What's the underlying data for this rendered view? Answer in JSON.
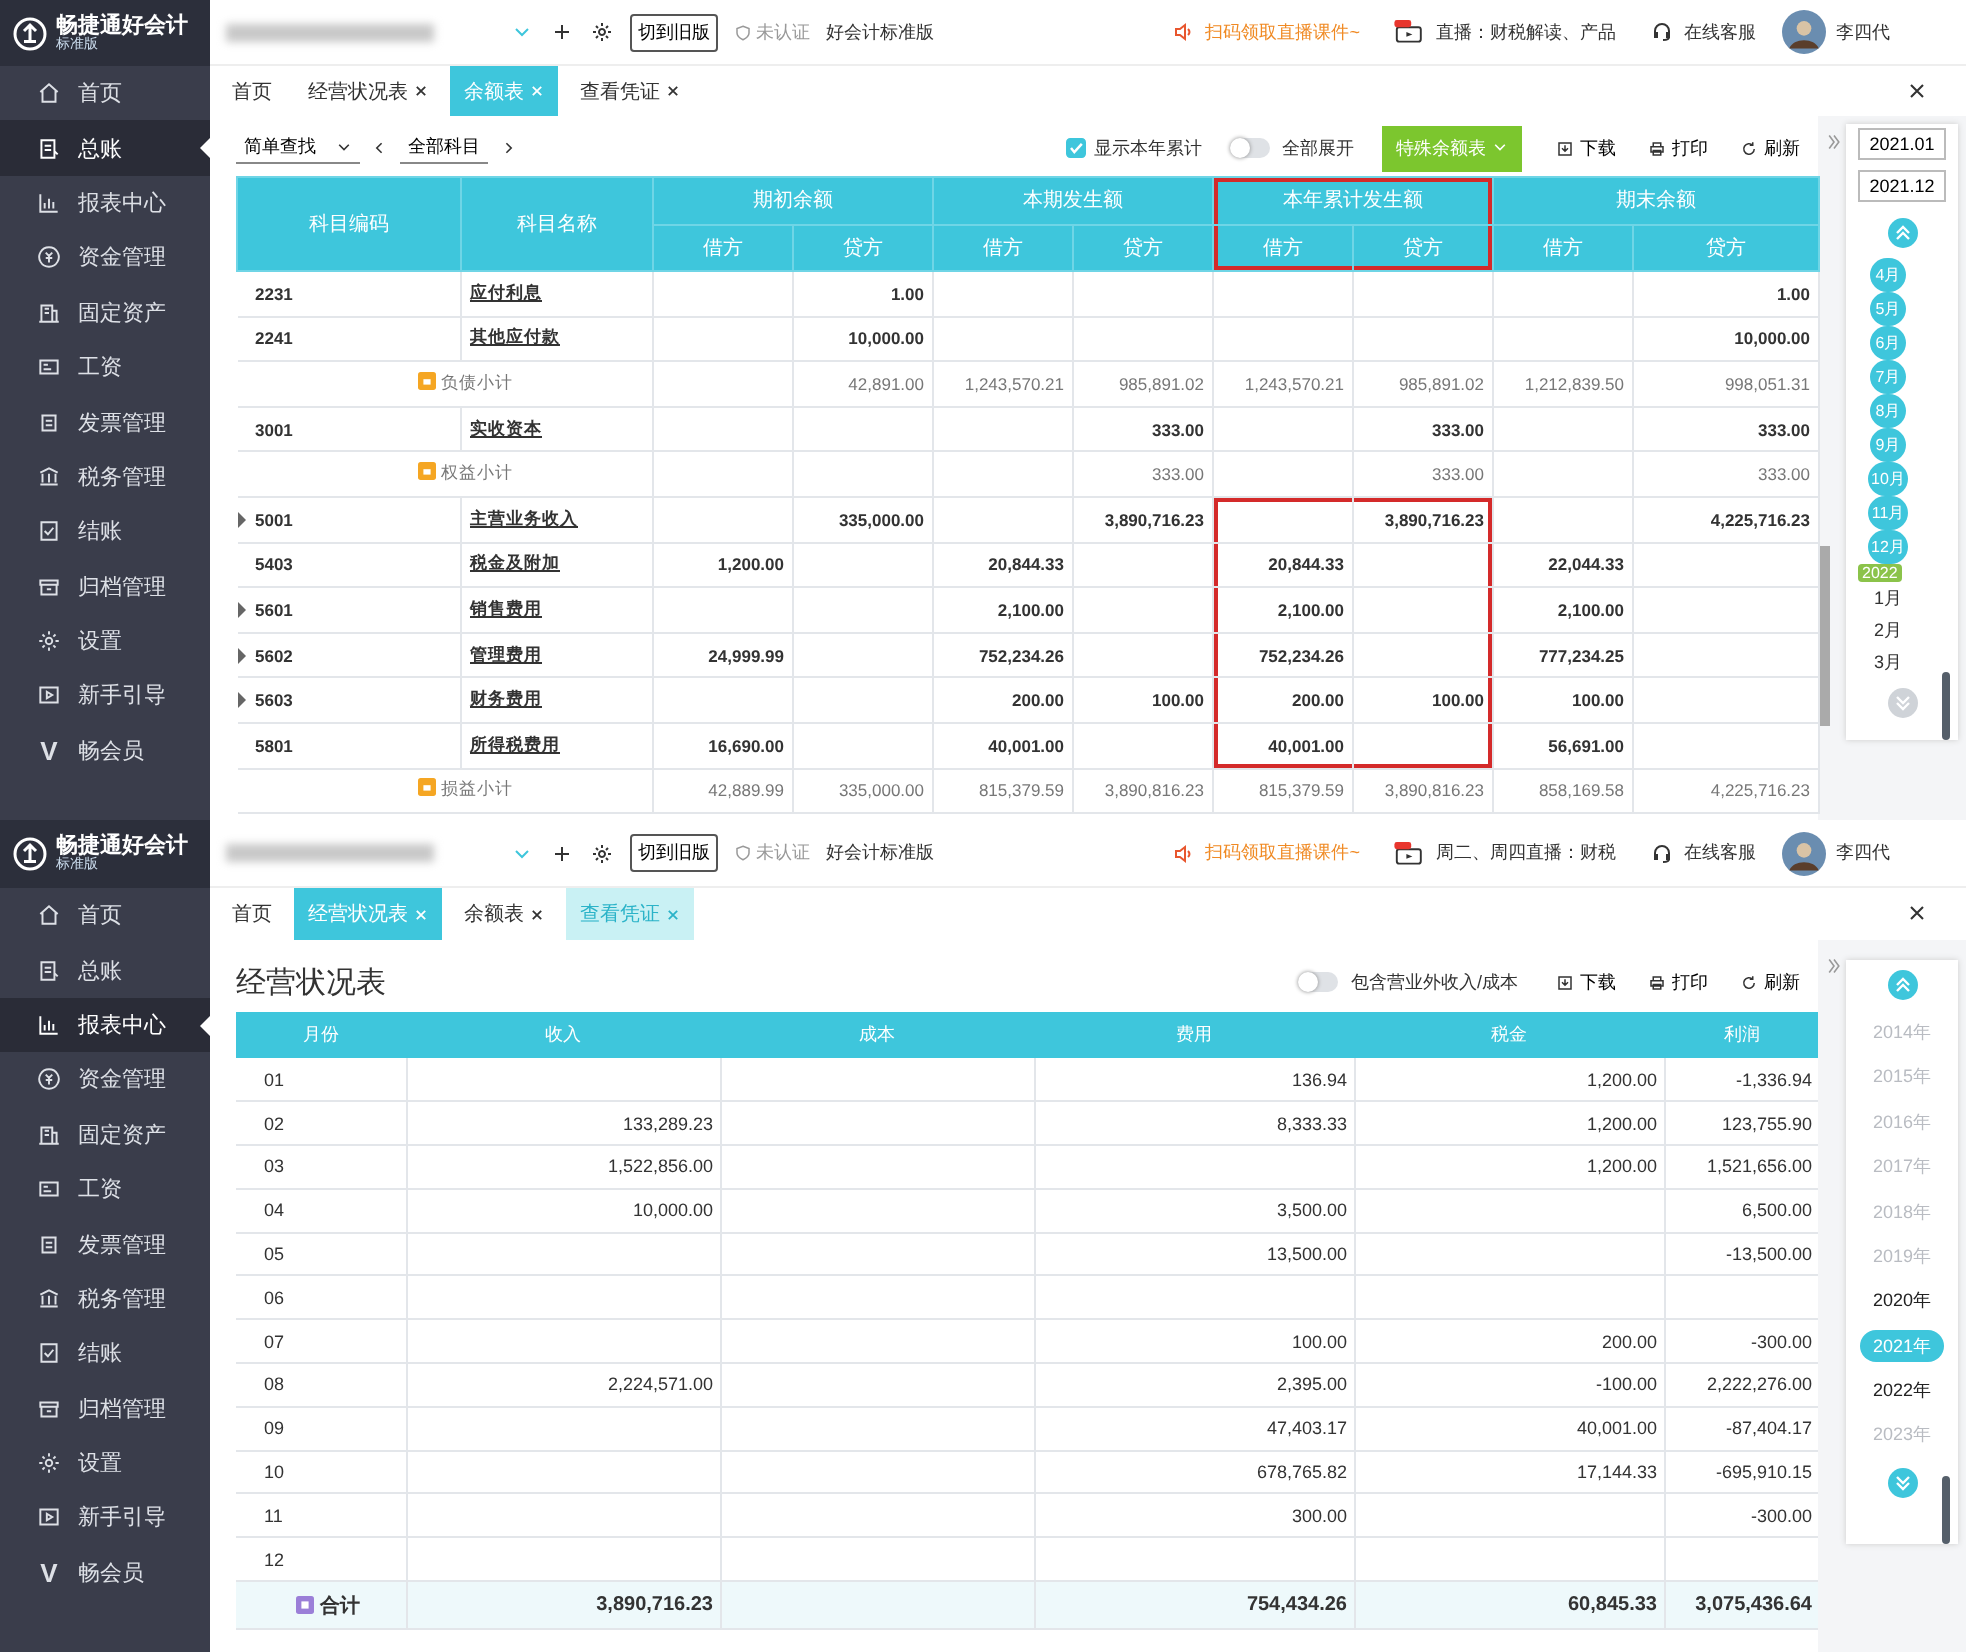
{
  "screens": [
    {
      "kind": "balance",
      "header": {
        "logo": "畅捷通好会计",
        "edition": "标准版",
        "switch_button": "切到旧版",
        "cert": "未认证",
        "product": "好会计标准版",
        "promo": "扫码领取直播课件~",
        "live": "直播：财税解读、产品",
        "service": "在线客服",
        "user": "李四代"
      },
      "sidebar": [
        {
          "label": "首页",
          "selected": false
        },
        {
          "label": "总账",
          "selected": true
        },
        {
          "label": "报表中心",
          "selected": false
        },
        {
          "label": "资金管理",
          "selected": false
        },
        {
          "label": "固定资产",
          "selected": false
        },
        {
          "label": "工资",
          "selected": false
        },
        {
          "label": "发票管理",
          "selected": false
        },
        {
          "label": "税务管理",
          "selected": false
        },
        {
          "label": "结账",
          "selected": false
        },
        {
          "label": "归档管理",
          "selected": false
        },
        {
          "label": "设置",
          "selected": false
        },
        {
          "label": "新手引导",
          "selected": false
        },
        {
          "label": "畅会员",
          "selected": false,
          "glyph": "V"
        }
      ],
      "tabs": [
        {
          "label": "首页",
          "closable": false,
          "selected": false,
          "highlighted": false
        },
        {
          "label": "经营状况表",
          "closable": true,
          "selected": false,
          "highlighted": false
        },
        {
          "label": "余额表",
          "closable": true,
          "selected": true,
          "highlighted": false
        },
        {
          "label": "查看凭证",
          "closable": true,
          "selected": false,
          "highlighted": false
        }
      ],
      "toolbar": {
        "search_mode": "简单查找",
        "scope": "全部科目",
        "show_year_total": {
          "label": "显示本年累计",
          "checked": true
        },
        "expand_all": {
          "label": "全部展开",
          "on": false
        },
        "special_button": "特殊余额表",
        "actions": [
          "下载",
          "打印",
          "刷新"
        ]
      },
      "table": {
        "code_header": "科目编码",
        "name_header": "科目名称",
        "groups": [
          {
            "label": "期初余额",
            "boxed": false,
            "sub": [
              "借方",
              "贷方"
            ]
          },
          {
            "label": "本期发生额",
            "boxed": false,
            "sub": [
              "借方",
              "贷方"
            ]
          },
          {
            "label": "本年累计发生额",
            "boxed": true,
            "sub": [
              "借方",
              "贷方"
            ]
          },
          {
            "label": "期末余额",
            "boxed": false,
            "sub": [
              "借方",
              "贷方"
            ]
          }
        ],
        "rows": [
          {
            "kind": "account",
            "code": "2231",
            "name": "应付利息",
            "expandable": false,
            "boxed": false,
            "opening_credit": "1.00",
            "closing_credit": "1.00"
          },
          {
            "kind": "account",
            "code": "2241",
            "name": "其他应付款",
            "expandable": false,
            "boxed": false,
            "opening_credit": "10,000.00",
            "closing_credit": "10,000.00"
          },
          {
            "kind": "subtotal",
            "name": "负债小计",
            "boxed": false,
            "opening_credit": "42,891.00",
            "period_debit": "1,243,570.21",
            "period_credit": "985,891.02",
            "ytd_debit": "1,243,570.21",
            "ytd_credit": "985,891.02",
            "closing_debit": "1,212,839.50",
            "closing_credit": "998,051.31"
          },
          {
            "kind": "account",
            "code": "3001",
            "name": "实收资本",
            "expandable": false,
            "boxed": false,
            "period_credit": "333.00",
            "ytd_credit": "333.00",
            "closing_credit": "333.00"
          },
          {
            "kind": "subtotal",
            "name": "权益小计",
            "boxed": false,
            "period_credit": "333.00",
            "ytd_credit": "333.00",
            "closing_credit": "333.00"
          },
          {
            "kind": "account",
            "code": "5001",
            "name": "主营业务收入",
            "expandable": true,
            "boxed": true,
            "opening_credit": "335,000.00",
            "period_credit": "3,890,716.23",
            "ytd_credit": "3,890,716.23",
            "closing_credit": "4,225,716.23"
          },
          {
            "kind": "account",
            "code": "5403",
            "name": "税金及附加",
            "expandable": false,
            "boxed": true,
            "opening_debit": "1,200.00",
            "period_debit": "20,844.33",
            "ytd_debit": "20,844.33",
            "closing_debit": "22,044.33"
          },
          {
            "kind": "account",
            "code": "5601",
            "name": "销售费用",
            "expandable": true,
            "boxed": true,
            "period_debit": "2,100.00",
            "ytd_debit": "2,100.00",
            "closing_debit": "2,100.00"
          },
          {
            "kind": "account",
            "code": "5602",
            "name": "管理费用",
            "expandable": true,
            "boxed": true,
            "opening_debit": "24,999.99",
            "period_debit": "752,234.26",
            "ytd_debit": "752,234.26",
            "closing_debit": "777,234.25"
          },
          {
            "kind": "account",
            "code": "5603",
            "name": "财务费用",
            "expandable": true,
            "boxed": true,
            "period_debit": "200.00",
            "period_credit": "100.00",
            "ytd_debit": "200.00",
            "ytd_credit": "100.00",
            "closing_debit": "100.00"
          },
          {
            "kind": "account",
            "code": "5801",
            "name": "所得税费用",
            "expandable": false,
            "boxed": true,
            "opening_debit": "16,690.00",
            "period_debit": "40,001.00",
            "ytd_debit": "40,001.00",
            "closing_debit": "56,691.00"
          },
          {
            "kind": "subtotal",
            "name": "损益小计",
            "boxed": false,
            "opening_debit": "42,889.99",
            "opening_credit": "335,000.00",
            "period_debit": "815,379.59",
            "period_credit": "3,890,816.23",
            "ytd_debit": "815,379.59",
            "ytd_credit": "3,890,816.23",
            "closing_debit": "858,169.58",
            "closing_credit": "4,225,716.23"
          }
        ]
      },
      "side_panel": {
        "kind": "months",
        "dates": [
          "2021.01",
          "2021.12"
        ],
        "up_button": {
          "disabled": false
        },
        "down_button": {
          "disabled": true
        },
        "items": [
          {
            "label": "4月",
            "selected": true
          },
          {
            "label": "5月",
            "selected": true
          },
          {
            "label": "6月",
            "selected": true
          },
          {
            "label": "7月",
            "selected": true
          },
          {
            "label": "8月",
            "selected": true
          },
          {
            "label": "9月",
            "selected": true
          },
          {
            "label": "10月",
            "selected": true
          },
          {
            "label": "11月",
            "selected": true
          },
          {
            "label": "12月",
            "selected": true
          },
          {
            "label": "1月",
            "selected": false,
            "year_badge": "2022"
          },
          {
            "label": "2月",
            "selected": false
          },
          {
            "label": "3月",
            "selected": false
          }
        ]
      }
    },
    {
      "kind": "report",
      "header": {
        "logo": "畅捷通好会计",
        "edition": "标准版",
        "switch_button": "切到旧版",
        "cert": "未认证",
        "product": "好会计标准版",
        "promo": "扫码领取直播课件~",
        "live": "周二、周四直播：财税",
        "service": "在线客服",
        "user": "李四代"
      },
      "sidebar": [
        {
          "label": "首页",
          "selected": false
        },
        {
          "label": "总账",
          "selected": false
        },
        {
          "label": "报表中心",
          "selected": true
        },
        {
          "label": "资金管理",
          "selected": false
        },
        {
          "label": "固定资产",
          "selected": false
        },
        {
          "label": "工资",
          "selected": false
        },
        {
          "label": "发票管理",
          "selected": false
        },
        {
          "label": "税务管理",
          "selected": false
        },
        {
          "label": "结账",
          "selected": false
        },
        {
          "label": "归档管理",
          "selected": false
        },
        {
          "label": "设置",
          "selected": false
        },
        {
          "label": "新手引导",
          "selected": false
        },
        {
          "label": "畅会员",
          "selected": false,
          "glyph": "V"
        }
      ],
      "tabs": [
        {
          "label": "首页",
          "closable": false,
          "selected": false,
          "highlighted": false
        },
        {
          "label": "经营状况表",
          "closable": true,
          "selected": true,
          "highlighted": false
        },
        {
          "label": "余额表",
          "closable": true,
          "selected": false,
          "highlighted": false
        },
        {
          "label": "查看凭证",
          "closable": true,
          "selected": false,
          "highlighted": true
        }
      ],
      "toolbar": {
        "title": "经营状况表",
        "toggle": {
          "label": "包含营业外收入/成本",
          "on": false
        },
        "actions": [
          "下载",
          "打印",
          "刷新"
        ]
      },
      "table": {
        "columns": [
          "月份",
          "收入",
          "成本",
          "费用",
          "税金",
          "利润"
        ],
        "rows": [
          {
            "month": "01",
            "expense": "136.94",
            "tax": "1,200.00",
            "profit": "-1,336.94"
          },
          {
            "month": "02",
            "income": "133,289.23",
            "expense": "8,333.33",
            "tax": "1,200.00",
            "profit": "123,755.90"
          },
          {
            "month": "03",
            "income": "1,522,856.00",
            "tax": "1,200.00",
            "profit": "1,521,656.00"
          },
          {
            "month": "04",
            "income": "10,000.00",
            "expense": "3,500.00",
            "profit": "6,500.00"
          },
          {
            "month": "05",
            "expense": "13,500.00",
            "profit": "-13,500.00"
          },
          {
            "month": "06"
          },
          {
            "month": "07",
            "expense": "100.00",
            "tax": "200.00",
            "profit": "-300.00"
          },
          {
            "month": "08",
            "income": "2,224,571.00",
            "expense": "2,395.00",
            "tax": "-100.00",
            "profit": "2,222,276.00"
          },
          {
            "month": "09",
            "expense": "47,403.17",
            "tax": "40,001.00",
            "profit": "-87,404.17"
          },
          {
            "month": "10",
            "expense": "678,765.82",
            "tax": "17,144.33",
            "profit": "-695,910.15"
          },
          {
            "month": "11",
            "expense": "300.00",
            "profit": "-300.00"
          },
          {
            "month": "12"
          }
        ],
        "total": {
          "label": "合计",
          "income": "3,890,716.23",
          "expense": "754,434.26",
          "tax": "60,845.33",
          "profit": "3,075,436.64"
        }
      },
      "side_panel": {
        "kind": "years",
        "up_button": {
          "disabled": false
        },
        "down_button": {
          "disabled": false
        },
        "items": [
          {
            "label": "2014年",
            "selected": false,
            "disabled": true
          },
          {
            "label": "2015年",
            "selected": false,
            "disabled": true
          },
          {
            "label": "2016年",
            "selected": false,
            "disabled": true
          },
          {
            "label": "2017年",
            "selected": false,
            "disabled": true
          },
          {
            "label": "2018年",
            "selected": false,
            "disabled": true
          },
          {
            "label": "2019年",
            "selected": false,
            "disabled": true
          },
          {
            "label": "2020年",
            "selected": false,
            "disabled": false
          },
          {
            "label": "2021年",
            "selected": true,
            "disabled": false
          },
          {
            "label": "2022年",
            "selected": false,
            "disabled": false
          },
          {
            "label": "2023年",
            "selected": false,
            "disabled": true
          }
        ]
      }
    }
  ]
}
